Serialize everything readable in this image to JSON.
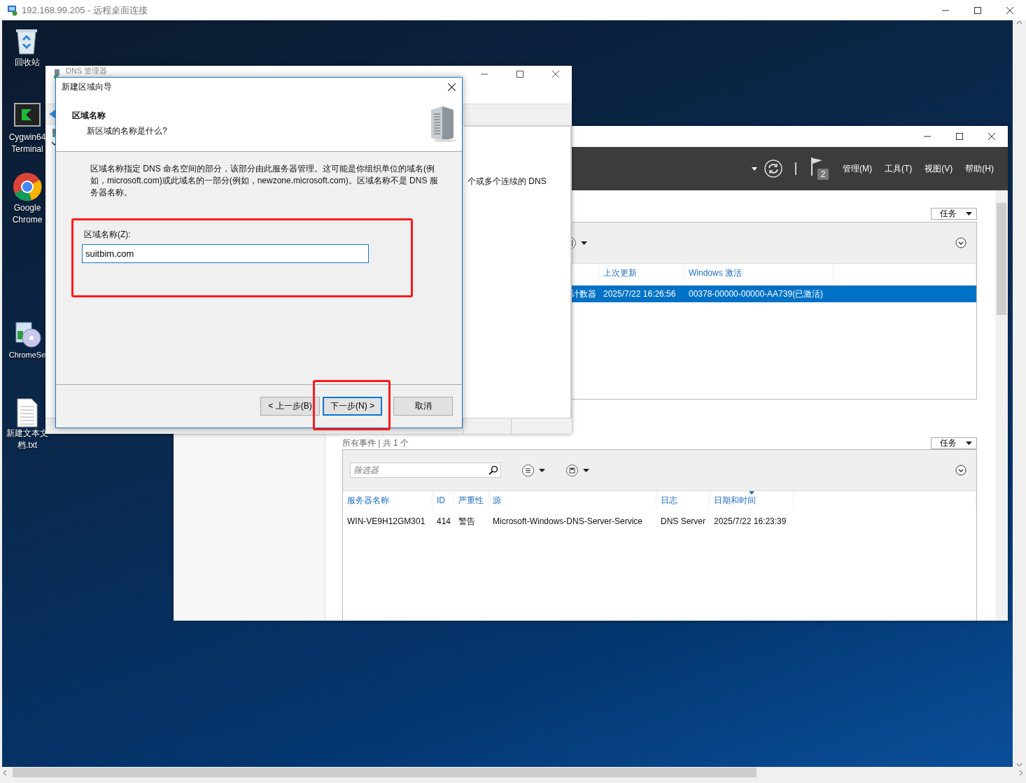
{
  "rdp_window": {
    "title": "192.168.99.205 - 远程桌面连接"
  },
  "desktop_icons": [
    {
      "label": "回收站",
      "kind": "recycle"
    },
    {
      "label": "Cygwin64 Terminal",
      "kind": "terminal"
    },
    {
      "label": "Google Chrome",
      "kind": "browser"
    },
    {
      "label": "ChromeSe",
      "kind": "setup"
    },
    {
      "label": "新建文本文档.txt",
      "kind": "textfile"
    }
  ],
  "server_manager": {
    "notification_count": "2",
    "menus": [
      "管理(M)",
      "工具(T)",
      "视图(V)",
      "帮助(H)"
    ],
    "properties": {
      "tasks_button": "任务",
      "columns": [
        {},
        {
          "label": "上次更新"
        },
        {
          "label": "Windows 激活"
        }
      ],
      "rows": [
        {
          "cells": [
            "计数器",
            "2025/7/22 16:26:56",
            "00378-00000-00000-AA739(已激活)"
          ],
          "selected": true
        }
      ]
    },
    "events": {
      "summary": "所有事件 | 共 1 个",
      "tasks_button": "任务",
      "filter": {
        "placeholder": "筛选器"
      },
      "columns": [
        {
          "label": "服务器名称",
          "sorted": false
        },
        {
          "label": "ID",
          "sorted": false
        },
        {
          "label": "严重性",
          "sorted": false
        },
        {
          "label": "源",
          "sorted": false
        },
        {
          "label": "日志",
          "sorted": false
        },
        {
          "label": "日期和时间",
          "sorted": true
        }
      ],
      "rows": [
        {
          "cells": [
            "WIN-VE9H12GM301",
            "414",
            "警告",
            "Microsoft-Windows-DNS-Server-Service",
            "DNS Server",
            "2025/7/22 16:23:39"
          ],
          "selected": false
        }
      ]
    }
  },
  "dns_manager": {
    "title": "DNS 管理器",
    "pane_text": "个或多个连续的 DNS"
  },
  "wizard": {
    "title": "新建区域向导",
    "heading": "区域名称",
    "subheading": "新区域的名称是什么?",
    "description": "区域名称指定 DNS 命名空间的部分，该部分由此服务器管理。这可能是你组织单位的域名(例如，microsoft.com)或此域名的一部分(例如，newzone.microsoft.com)。区域名称不是 DNS 服务器名称。",
    "field": {
      "label": "区域名称(Z):",
      "value": "suitbim.com",
      "annotated": true
    },
    "buttons": [
      {
        "label": "< 上一步(B)",
        "focused": false,
        "annotated": false
      },
      {
        "label": "下一步(N) >",
        "focused": true,
        "annotated": true
      },
      {
        "label": "取消",
        "focused": false,
        "annotated": false
      }
    ]
  }
}
